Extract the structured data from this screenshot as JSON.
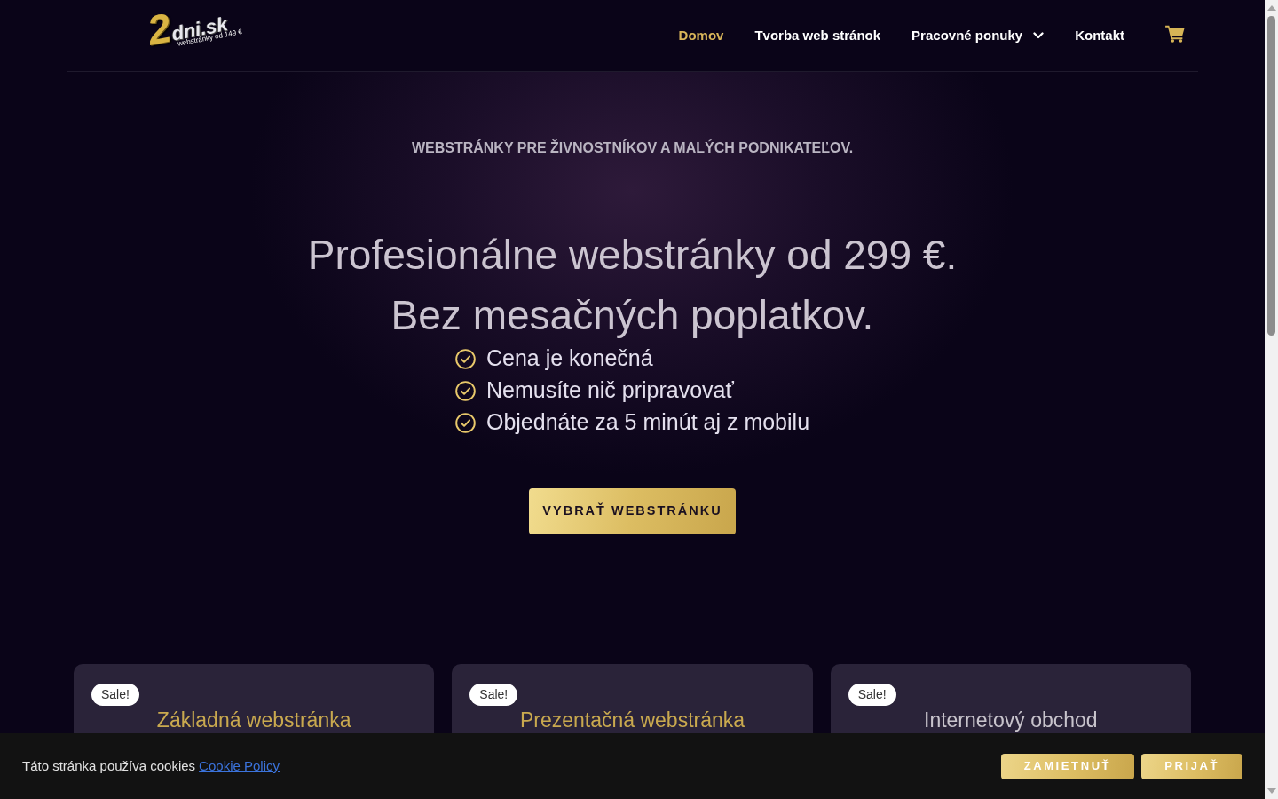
{
  "navbar": {
    "logo": {
      "digit": "2",
      "wordmark": "dni.sk",
      "tagline": "webstránky od 149 €"
    },
    "links": [
      {
        "label": "Domov",
        "selected": true,
        "dropdown": false
      },
      {
        "label": "Tvorba web stránok",
        "selected": false,
        "dropdown": false
      },
      {
        "label": "Pracovné ponuky",
        "selected": false,
        "dropdown": true
      },
      {
        "label": "Kontakt",
        "selected": false,
        "dropdown": false
      }
    ]
  },
  "hero": {
    "eyebrow": "WEBSTRÁNKY PRE ŽIVNOSTNÍKOV A MALÝCH PODNIKATEĽOV.",
    "headline_lines": [
      "Profesionálne webstránky od 299 €.",
      "Bez mesačných poplatkov."
    ],
    "benefits": [
      "Cena je konečná",
      "Nemusíte nič pripravovať",
      "Objednáte za 5 minút aj z mobilu"
    ],
    "button": "VYBRAŤ WEBSTRÁNKU"
  },
  "products": [
    {
      "badge": "Sale!",
      "title": "Základná webstránka",
      "color": "#c9a94f"
    },
    {
      "badge": "Sale!",
      "title": "Prezentačná webstránka",
      "color": "#c9a94f"
    },
    {
      "badge": "Sale!",
      "title": "Internetový obchod",
      "color": "#c8c4cc"
    }
  ],
  "cookie_bar": {
    "text": "Táto stránka používa cookies",
    "link": "Cookie Policy",
    "buttons": [
      "ZAMIETNUŤ",
      "PRIJAŤ"
    ]
  }
}
